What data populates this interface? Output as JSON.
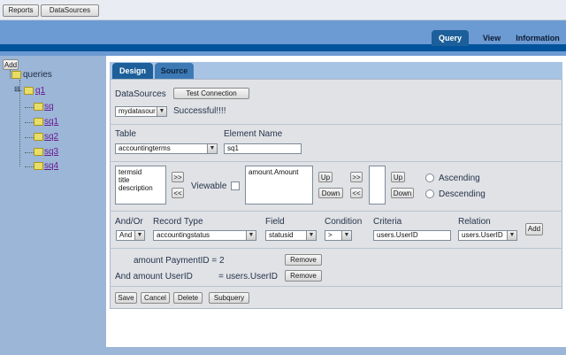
{
  "topbar": {
    "reports": "Reports",
    "datasources": "DataSources"
  },
  "nav": {
    "query": "Query",
    "view": "View",
    "information": "Information"
  },
  "sidebar": {
    "add": "Add",
    "root": "queries",
    "node": "q1",
    "children": [
      "sq",
      "sq1",
      "sq2",
      "sq3",
      "sq4"
    ]
  },
  "tabs": {
    "design": "Design",
    "source": "Source"
  },
  "datasource": {
    "label": "DataSources",
    "test_button": "Test Connection",
    "selected": "mydatasour",
    "status": "Successful!!!!"
  },
  "table_section": {
    "table_label": "Table",
    "table_value": "accountingterms",
    "element_label": "Element Name",
    "element_value": "sq1"
  },
  "columns": {
    "available": [
      "termsid",
      "title",
      "description"
    ],
    "move_right": ">>",
    "move_left": "<<",
    "viewable": "Viewable",
    "selected": [
      "amount.Amount"
    ],
    "up": "Up",
    "down": "Down",
    "order_right": ">>",
    "order_left": "<<",
    "order_up": "Up",
    "order_down": "Down",
    "ascending": "Ascending",
    "descending": "Descending"
  },
  "criteria": {
    "andor_label": "And/Or",
    "andor_value": "And",
    "recordtype_label": "Record Type",
    "recordtype_value": "accountingstatus",
    "field_label": "Field",
    "field_value": "statusid",
    "condition_label": "Condition",
    "condition_value": ">",
    "criteria_label": "Criteria",
    "criteria_value": "users.UserID",
    "relation_label": "Relation",
    "relation_value": "users.UserID",
    "add_button": "Add"
  },
  "conditions": [
    {
      "text": "amount PaymentID = 2",
      "remove": "Remove"
    },
    {
      "text": "And amount UserID",
      "rhs": "= users.UserID",
      "remove": "Remove"
    }
  ],
  "actions": {
    "save": "Save",
    "cancel": "Cancel",
    "delete": "Delete",
    "subquery": "Subquery"
  }
}
